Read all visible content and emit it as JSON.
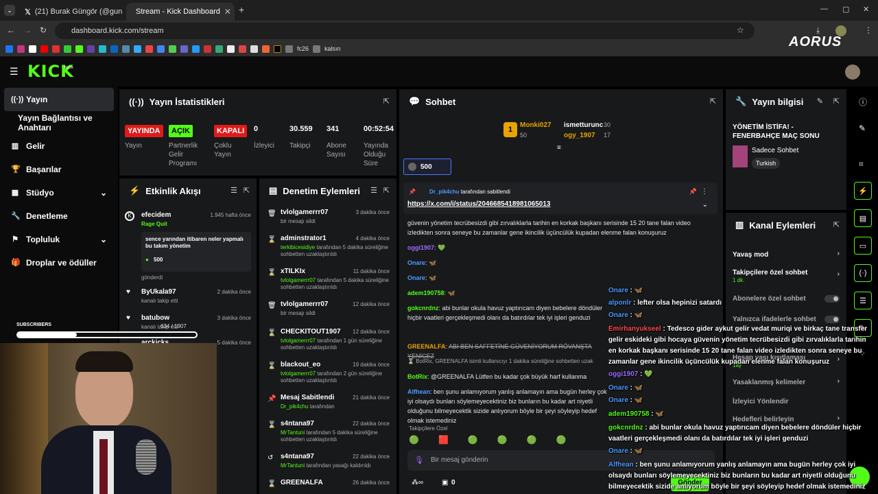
{
  "browser": {
    "tabs": [
      {
        "label": "(21) Burak Güngör (@gungorbu"
      },
      {
        "label": "Stream - Kick Dashboard"
      }
    ],
    "url": "dashboard.kick.com/stream",
    "bookmarks": [
      "fc26",
      "kalsın"
    ],
    "watermark": "AORUS"
  },
  "kick": {
    "logo": "KICK",
    "beta": "BETA"
  },
  "sidebar": {
    "items": [
      {
        "label": "Yayın"
      },
      {
        "label": "Yayın Bağlantısı ve Anahtarı"
      },
      {
        "label": "Gelir"
      },
      {
        "label": "Başarılar"
      },
      {
        "label": "Stüdyo"
      },
      {
        "label": "Denetleme"
      },
      {
        "label": "Topluluk"
      },
      {
        "label": "Droplar ve ödüller"
      }
    ]
  },
  "stats": {
    "title": "Yayın İstatistikleri",
    "cells": [
      {
        "value": "YAYINDA",
        "label": "Yayın"
      },
      {
        "value": "AÇIK",
        "label": "Partnerlik Gelir Programı"
      },
      {
        "value": "KAPALI",
        "label": "Çoklu Yayın"
      },
      {
        "value": "0",
        "label": "İzleyici"
      },
      {
        "value": "30.559",
        "label": "Takipçi"
      },
      {
        "value": "341",
        "label": "Abone Sayısı"
      },
      {
        "value": "00:52:54",
        "label": "Yayında Olduğu Süre"
      }
    ]
  },
  "activity": {
    "title": "Etkinlik Akışı",
    "items": [
      {
        "name": "efecidem",
        "time": "1.945 hafta önce",
        "sub": "Rage Quit",
        "message": "sence yarından itibaren neler yapmalı bu takım yönetim",
        "amount": "500",
        "action": "gönderdi"
      },
      {
        "name": "ByUkala97",
        "time": "2 dakika önce",
        "action": "kanalı takip etti"
      },
      {
        "name": "batubow",
        "time": "3 dakika önce",
        "action": "kanalı takip etti"
      },
      {
        "name": "arckicks",
        "time": "5 dakika önce"
      }
    ]
  },
  "subscribers": {
    "label": "SUBSCRIBERS",
    "count": "634 / 1907",
    "progress": 0.33
  },
  "moderation": {
    "title": "Denetim Eylemleri",
    "items": [
      {
        "name": "tvlolgamerrr07",
        "time": "3 dakika önce",
        "desc": "bir mesajı sildi"
      },
      {
        "name": "adminstrator1",
        "time": "4 dakika önce",
        "by": "terkibicesidiye",
        "desc": "tarafından 5 dakika süreliğine sohbetten uzaklaştırıldı"
      },
      {
        "name": "xTILKIx",
        "time": "11 dakika önce",
        "by": "tvlolgamerrr07",
        "desc": "tarafından 5 dakika süreliğine sohbetten uzaklaştırıldı"
      },
      {
        "name": "tvlolgamerrr07",
        "time": "12 dakika önce",
        "desc": "bir mesajı sildi"
      },
      {
        "name": "CHECKITOUT1907",
        "time": "12 dakika önce",
        "by": "tvlolgamerrr07",
        "desc": "tarafından 1 gün süreliğine sohbetten uzaklaştırıldı"
      },
      {
        "name": "blackout_eo",
        "time": "19 dakika önce",
        "by": "tvlolgamerrr07",
        "desc": "tarafından 2 gün süreliğine sohbetten uzaklaştırıldı"
      },
      {
        "name": "Mesaj Sabitlendi",
        "time": "21 dakika önce",
        "by": "Dr_pik4chu",
        "desc": "tarafından"
      },
      {
        "name": "s4ntana97",
        "time": "22 dakika önce",
        "by": "MrTantuni",
        "desc": "tarafından 5 dakika süreliğine sohbetten uzaklaştırıldı"
      },
      {
        "name": "s4ntana97",
        "time": "22 dakika önce",
        "by": "MrTantuni",
        "desc": "tarafından yasağı kaldırıldı"
      },
      {
        "name": "GREENALFA",
        "time": "26 dakika önce",
        "by": "",
        "desc": ""
      }
    ]
  },
  "chat": {
    "title": "Sohbet",
    "leaders": [
      {
        "name": "Monki027",
        "value": "50"
      },
      {
        "name": "ismetturunc",
        "value": "30"
      },
      {
        "name": "ogy_1907",
        "value": "17"
      }
    ],
    "kicks_total": "500",
    "pinned_by": "Dr_pik4chu",
    "pinned_suffix": "tarafından sabitlendi",
    "pinned_link": "https://x.com/i/status/2046685418981065013",
    "lines": [
      {
        "user": "",
        "text": "güvenin yönetim tecrübesizdi gibi zırvalıklarla tarihin en korkak başkanı serisinde 15 20 tane falan video izledikten sonra seneye bu zamanlar gene ikincilik üçüncülük kupadan elenme falan konuşuruz"
      },
      {
        "user": "oggi1907",
        "text": "💚"
      },
      {
        "user": "Onare",
        "text": "🦋"
      },
      {
        "user": "Onare",
        "text": "🦋"
      },
      {
        "user": "adem190758",
        "text": "🦋"
      },
      {
        "user": "gokcnrdnz",
        "text": "abi bunlar okula havuz yaptırıcam diyen bebelere döndüler hiçbir vaatleri gerçekleşmedi olanı da batırdılar tek iyi işleri genduzi"
      },
      {
        "user": "Onare",
        "text": "🦋"
      },
      {
        "user": "GREENALFA",
        "text": "ABI BEN SAFFETİNE GÜVENİYORUM RÖVANŞTA YENİCEZ"
      },
      {
        "user": "BotRix, GREENALFA",
        "text": "isimli kullanıcıyı 1 dakika süreliğine sohbetten uzak"
      },
      {
        "user": "BotRix",
        "text": "@GREENALFA Lütfen bu kadar çok büyük harf kullanma"
      },
      {
        "user": "Alfhean",
        "text": "ben şunu anlamıyorum yanlış anlamayın ama bugün herley çok iyi olsaydı bunları söylemeyecektiniz biz bunların bu kadar art niyetli olduğunu bilmeyecektik sizide anlıyorum böyle bir şeyi söyleyip hedef olmak istemediniz"
      }
    ],
    "followers_label": "Takipçilere Özel",
    "input_placeholder": "Bir mesaj gönderin",
    "footer_count": "0",
    "send_label": "Gönder"
  },
  "overlay_chat": [
    {
      "user": "Onare",
      "text": "🦋"
    },
    {
      "user": "alponlr",
      "text": "lefter olsa hepinizi satardı"
    },
    {
      "user": "Onare",
      "text": "🦋"
    },
    {
      "user": "Emirhanyukseel",
      "text": "Tedesco gider aykut gelir vedat muriqi ve birkaç tane transfer gelir eskideki gibi hocaya güvenin yönetim tecrübesizdi gibi zırvalıklarla tarihin en korkak başkanı serisinde 15 20 tane falan video izledikten sonra seneye bu zamanlar gene ikincilik üçüncülük kupadan elenme falan konuşuruz"
    },
    {
      "user": "oggi1907",
      "text": "💚"
    },
    {
      "user": "Onare",
      "text": "🦋"
    },
    {
      "user": "Onare",
      "text": "🦋"
    },
    {
      "user": "adem190758",
      "text": "🦋"
    },
    {
      "user": "gokcnrdnz",
      "text": "abi bunlar okula havuz yaptırıcam diyen bebelere döndüler hiçbir vaatleri gerçekleşmedi olanı da batırdılar tek iyi işleri genduzi"
    },
    {
      "user": "Onare",
      "text": "🦋"
    },
    {
      "user": "Alfhean",
      "text": "ben şunu anlamıyorum yanlış anlamayın ama bugün herley çok iyi olsaydı bunları söylemeyecektiniz biz bunların bu kadar art niyetli olduğunu bilmeyecektik sizide anlıyorum böyle bir şeyi söyleyip hedef olmak istemediniz"
    }
  ],
  "info": {
    "title": "Yayın bilgisi",
    "stream_title": "YÖNETİM İSTİFA! - FENERBAHÇE MAÇ SONU",
    "category": "Sadece Sohbet",
    "tag": "Turkish"
  },
  "channel": {
    "title": "Kanal Eylemleri",
    "items": [
      {
        "label": "Yavaş mod",
        "sub": ""
      },
      {
        "label": "Takipçilere özel sohbet",
        "sub": "1 dk."
      },
      {
        "label": "Abonelere özel sohbet",
        "sub": ""
      },
      {
        "label": "Yalnızca ifadelerle sohbet",
        "sub": ""
      },
      {
        "label": "Hesap yaşı kısıtlaması",
        "sub": "1ay"
      },
      {
        "label": "Yasaklanmış kelimeler",
        "sub": ""
      },
      {
        "label": "İzleyici Yönlendir",
        "sub": ""
      },
      {
        "label": "Hedefleri belirleyin",
        "sub": ""
      }
    ]
  }
}
